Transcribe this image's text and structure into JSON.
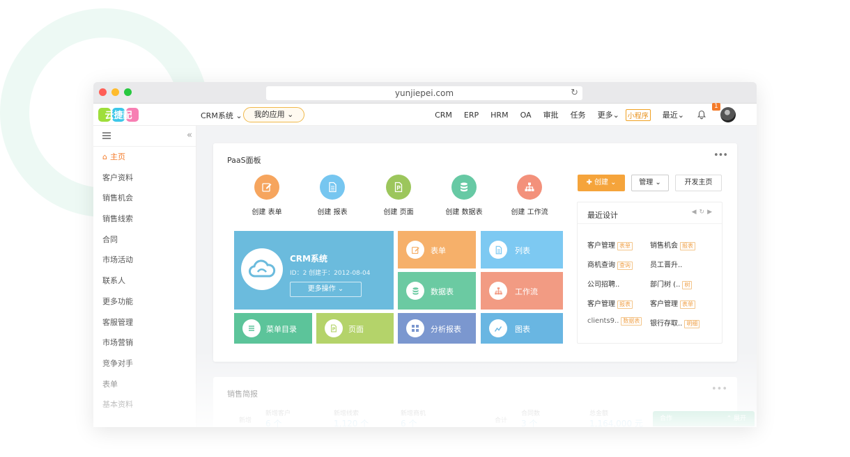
{
  "browser": {
    "url": "yunjiepei.com"
  },
  "logo": {
    "text": "云捷配"
  },
  "topnav": {
    "crm_label": "CRM系统",
    "myapps_label": "我的应用",
    "items": [
      "CRM",
      "ERP",
      "HRM",
      "OA",
      "审批",
      "任务",
      "更多"
    ],
    "mini_program": "小程序",
    "recent": "最近",
    "notification_count": "1"
  },
  "sidebar": {
    "items": [
      "主页",
      "客户资料",
      "销售机会",
      "销售线索",
      "合同",
      "市场活动",
      "联系人",
      "更多功能",
      "客服管理",
      "市场营销",
      "竞争对手",
      "表单",
      "基本资料"
    ]
  },
  "paas": {
    "title": "PaaS面板",
    "quick": [
      {
        "label": "创建 表单",
        "icon": "edit-icon",
        "color": "#f6a55e"
      },
      {
        "label": "创建 报表",
        "icon": "document-icon",
        "color": "#76c6f0"
      },
      {
        "label": "创建 页面",
        "icon": "page-icon",
        "color": "#9cc65c"
      },
      {
        "label": "创建 数据表",
        "icon": "database-icon",
        "color": "#67c9a4"
      },
      {
        "label": "创建 工作流",
        "icon": "workflow-icon",
        "color": "#f3917b"
      }
    ],
    "crm_tile": {
      "name": "CRM系统",
      "meta": "ID：2   创建于：2012-08-04",
      "button": "更多操作"
    },
    "tiles": [
      {
        "label": "表单",
        "color": "#f6b06a"
      },
      {
        "label": "列表",
        "color": "#7dc9f2"
      },
      {
        "label": "数据表",
        "color": "#6bcaa2"
      },
      {
        "label": "工作流",
        "color": "#f29b83"
      },
      {
        "label": "菜单目录",
        "color": "#5cc49a"
      },
      {
        "label": "页面",
        "color": "#b4d36a"
      },
      {
        "label": "分析报表",
        "color": "#7b97cf"
      },
      {
        "label": "图表",
        "color": "#69b6e2"
      }
    ],
    "buttons": {
      "create": "创建",
      "manage": "管理",
      "dev_home": "开发主页"
    },
    "recent_design": {
      "title": "最近设计",
      "items": [
        {
          "name": "客户管理",
          "tag": "表单"
        },
        {
          "name": "销售机会",
          "tag": "报表"
        },
        {
          "name": "商机查询",
          "tag": "查询"
        },
        {
          "name": "员工晋升..",
          "tag": ""
        },
        {
          "name": "公司招聘..",
          "tag": ""
        },
        {
          "name": "部门树 (..",
          "tag": "树"
        },
        {
          "name": "客户管理",
          "tag": "报表"
        },
        {
          "name": "客户管理",
          "tag": "表单"
        },
        {
          "name": "clients9..",
          "tag": "数据表"
        },
        {
          "name": "银行存取..",
          "tag": "明细"
        }
      ]
    }
  },
  "sales": {
    "title": "销售简报",
    "left_side": "新增",
    "right_side": "合计",
    "stats": [
      {
        "label": "新增客户",
        "value": "6 个"
      },
      {
        "label": "新增线索",
        "value": "1,120 个"
      },
      {
        "label": "新增商机",
        "value": "6 个"
      },
      {
        "label": "合同数",
        "value": "3 个"
      },
      {
        "label": "总金额",
        "value": "1,164,000 元"
      }
    ]
  },
  "chatbar": {
    "label": "合作",
    "expand": "展开"
  },
  "colors": {
    "accent": "#f47b2a",
    "create_button": "#f5a43b",
    "crm_tile": "#6bbbdd"
  }
}
